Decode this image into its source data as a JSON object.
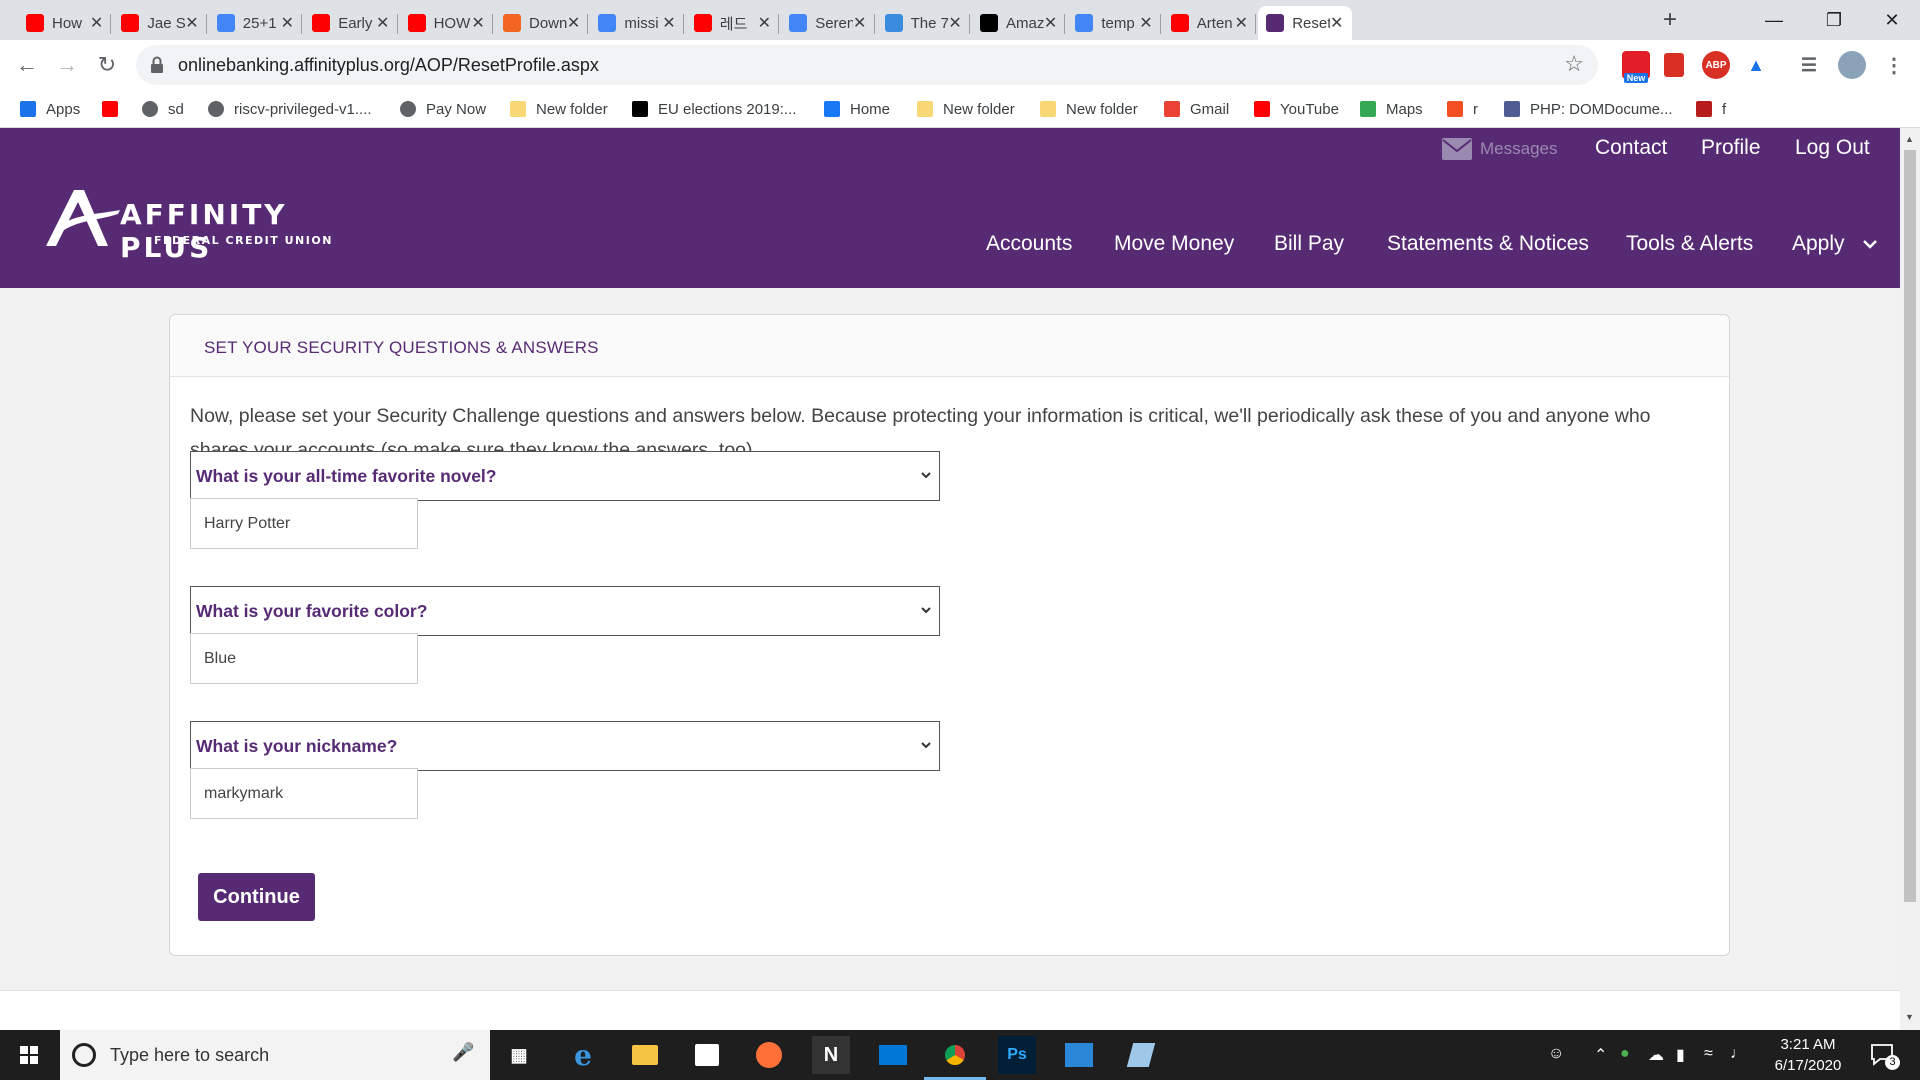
{
  "browser": {
    "tabs": [
      {
        "title": "How",
        "favicon": "youtube-icon",
        "color": "#ff0000"
      },
      {
        "title": "Jae Se",
        "favicon": "youtube-icon",
        "color": "#ff0000"
      },
      {
        "title": "25+1",
        "favicon": "google-icon",
        "color": "#4285f4"
      },
      {
        "title": "Early",
        "favicon": "youtube-icon",
        "color": "#ff0000"
      },
      {
        "title": "HOW",
        "favicon": "youtube-icon",
        "color": "#ff0000"
      },
      {
        "title": "Down",
        "favicon": "download-site-icon",
        "color": "#f26522"
      },
      {
        "title": "missi",
        "favicon": "google-icon",
        "color": "#4285f4"
      },
      {
        "title": "레드",
        "favicon": "youtube-icon",
        "color": "#ff0000"
      },
      {
        "title": "Seren",
        "favicon": "google-icon",
        "color": "#4285f4"
      },
      {
        "title": "The 7",
        "favicon": "globe-icon",
        "color": "#3a8dde"
      },
      {
        "title": "Amaz",
        "favicon": "amazon-icon",
        "color": "#000000"
      },
      {
        "title": "temp",
        "favicon": "google-icon",
        "color": "#4285f4"
      },
      {
        "title": "Arten",
        "favicon": "youtube-icon",
        "color": "#ff0000"
      },
      {
        "title": "Reset",
        "favicon": "affinity-plus-icon",
        "color": "#572a74",
        "active": true
      }
    ],
    "url": "onlinebanking.affinityplus.org/AOP/ResetProfile.aspx",
    "bookmarks": [
      {
        "label": "Apps",
        "icon": "apps-grid-icon"
      },
      {
        "label": "",
        "icon": "youtube-icon"
      },
      {
        "label": "sd",
        "icon": "globe-icon"
      },
      {
        "label": "riscv-privileged-v1....",
        "icon": "globe-icon"
      },
      {
        "label": "Pay Now",
        "icon": "globe-icon"
      },
      {
        "label": "New folder",
        "icon": "folder-icon"
      },
      {
        "label": "EU elections 2019:...",
        "icon": "bbc-icon"
      },
      {
        "label": "Home",
        "icon": "facebook-icon"
      },
      {
        "label": "New folder",
        "icon": "folder-icon"
      },
      {
        "label": "New folder",
        "icon": "folder-icon"
      },
      {
        "label": "Gmail",
        "icon": "gmail-icon"
      },
      {
        "label": "YouTube",
        "icon": "youtube-icon"
      },
      {
        "label": "Maps",
        "icon": "maps-icon"
      },
      {
        "label": "r",
        "icon": "microsoft-icon"
      },
      {
        "label": "PHP: DOMDocume...",
        "icon": "php-icon"
      },
      {
        "label": "f",
        "icon": "bird-icon"
      }
    ],
    "extension_badge": "New",
    "abp_label": "ABP"
  },
  "site": {
    "brand": "AFFINITY PLUS",
    "brand_sub": "FEDERAL CREDIT UNION",
    "top_links": {
      "messages": "Messages",
      "contact": "Contact",
      "profile": "Profile",
      "logout": "Log Out"
    },
    "nav": [
      "Accounts",
      "Move Money",
      "Bill Pay",
      "Statements & Notices",
      "Tools & Alerts",
      "Apply"
    ],
    "accent_color": "#572a74"
  },
  "card": {
    "title": "SET YOUR SECURITY QUESTIONS & ANSWERS",
    "intro": "Now, please set your Security Challenge questions and answers below. Because protecting your information is critical, we'll periodically ask these of you and anyone who shares your accounts (so make sure they know the answers, too).",
    "questions": [
      {
        "question": "What is your all-time favorite novel?",
        "answer": "Harry Potter"
      },
      {
        "question": "What is your favorite color?",
        "answer": "Blue"
      },
      {
        "question": "What is your nickname?",
        "answer": "markymark"
      }
    ],
    "continue_label": "Continue"
  },
  "taskbar": {
    "search_placeholder": "Type here to search",
    "time": "3:21 AM",
    "date": "6/17/2020",
    "notification_count": "3"
  }
}
